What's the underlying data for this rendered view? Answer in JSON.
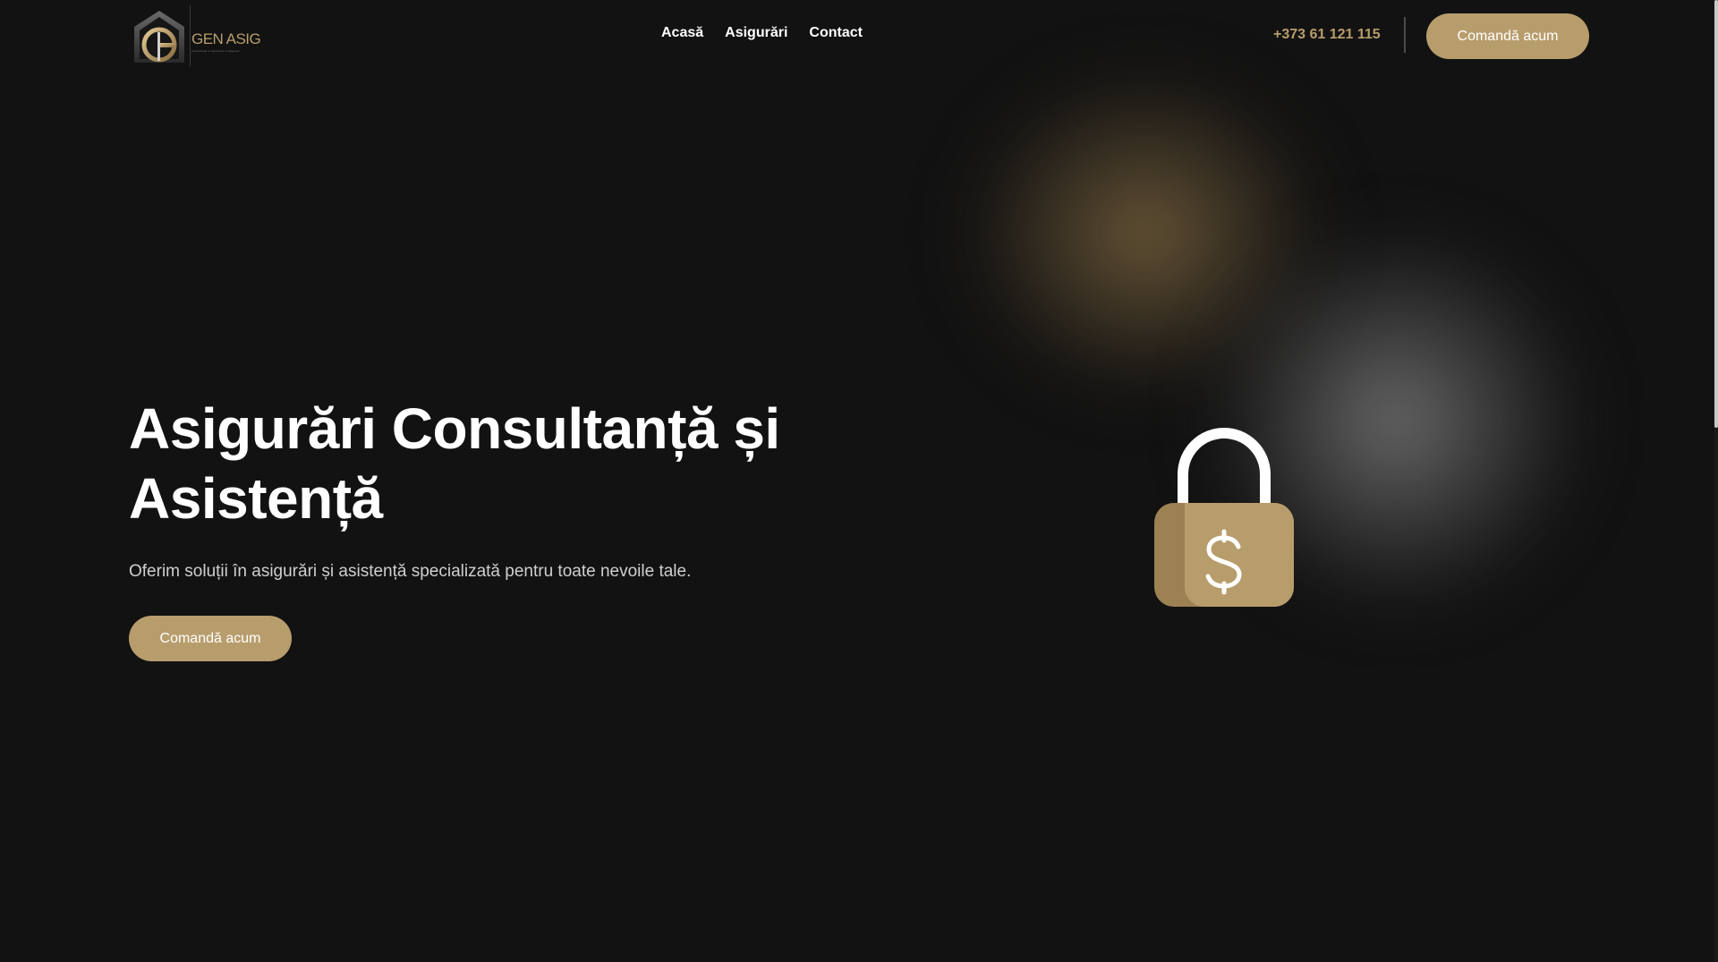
{
  "brand": {
    "name": "GEN ASIG",
    "tagline": "consultanta si asistenta in asigurari",
    "accent_color": "#b89d6c",
    "background_color": "#121212"
  },
  "nav": {
    "items": [
      {
        "label": "Acasă"
      },
      {
        "label": "Asigurări"
      },
      {
        "label": "Contact"
      }
    ]
  },
  "header": {
    "phone": "+373 61 121 115",
    "cta_label": "Comandă acum"
  },
  "hero": {
    "title": "Asigurări Consultanță și Asistență",
    "subtitle": "Oferim soluții în asigurări și asistență specializată pentru toate nevoile tale.",
    "cta_label": "Comandă acum",
    "illustration_icon": "padlock-dollar-icon"
  }
}
